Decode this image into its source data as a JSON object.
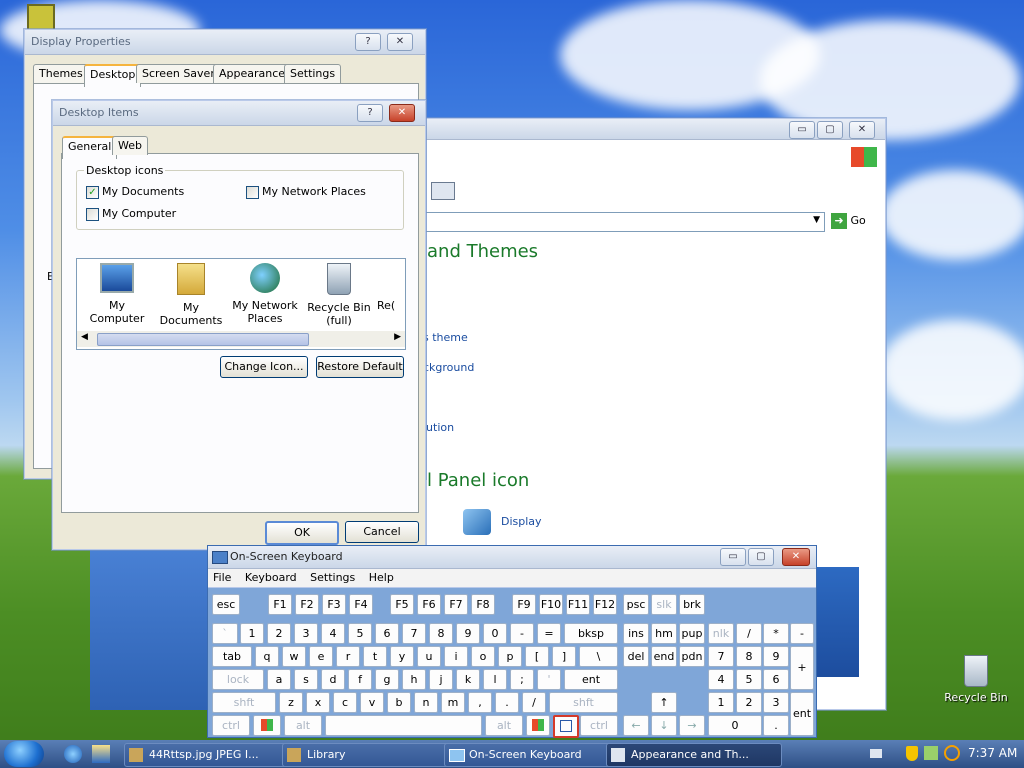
{
  "desktop": {
    "recycle_bin_label": "Recycle Bin",
    "background_colors": {
      "sky": "#2a66d8",
      "grass": "#4c8e24"
    }
  },
  "display_properties": {
    "title": "Display Properties",
    "tabs": [
      "Themes",
      "Desktop",
      "Screen Saver",
      "Appearance",
      "Settings"
    ],
    "active_tab": "Desktop",
    "help_btn": "?",
    "close_btn": "✕",
    "partial_label": "B"
  },
  "desktop_items": {
    "title": "Desktop Items",
    "help_btn": "?",
    "close_btn": "✕",
    "tabs": [
      "General",
      "Web"
    ],
    "group_label": "Desktop icons",
    "checkboxes": [
      {
        "label": "My Documents",
        "checked": true
      },
      {
        "label": "My Network Places",
        "checked": false
      },
      {
        "label": "My Computer",
        "checked": false
      }
    ],
    "icons": [
      {
        "label": "My Computer",
        "icon": "computer-icon"
      },
      {
        "label": "My Documents",
        "icon": "folder-icon"
      },
      {
        "label": "My Network Places",
        "icon": "network-icon"
      },
      {
        "label": "Recycle Bin (full)",
        "icon": "recycle-bin-icon"
      },
      {
        "label": "Re(",
        "icon": "partial-icon"
      }
    ],
    "change_icon_btn": "Change Icon...",
    "restore_default_btn": "Restore Default",
    "ok_btn": "OK",
    "cancel_btn": "Cancel"
  },
  "control_panel": {
    "heading_1": "and Themes",
    "link_1": "s theme",
    "link_2": "ckground",
    "link_3": "lution",
    "heading_2": "l Panel icon",
    "display_label": "Display",
    "go_label": "Go",
    "min": "▭",
    "max": "▢",
    "close": "✕"
  },
  "osk": {
    "title": "On-Screen Keyboard",
    "menu": [
      "File",
      "Keyboard",
      "Settings",
      "Help"
    ],
    "rows": {
      "r1": [
        "esc",
        "F1",
        "F2",
        "F3",
        "F4",
        "F5",
        "F6",
        "F7",
        "F8",
        "F9",
        "F10",
        "F11",
        "F12",
        "psc",
        "slk",
        "brk"
      ],
      "r2": [
        "`",
        "1",
        "2",
        "3",
        "4",
        "5",
        "6",
        "7",
        "8",
        "9",
        "0",
        "-",
        "=",
        "bksp",
        "ins",
        "hm",
        "pup",
        "nlk",
        "/",
        "*",
        "-"
      ],
      "r3": [
        "tab",
        "q",
        "w",
        "e",
        "r",
        "t",
        "y",
        "u",
        "i",
        "o",
        "p",
        "[",
        "]",
        "\\",
        "del",
        "end",
        "pdn",
        "7",
        "8",
        "9",
        "+"
      ],
      "r4": [
        "lock",
        "a",
        "s",
        "d",
        "f",
        "g",
        "h",
        "j",
        "k",
        "l",
        ";",
        "'",
        "ent",
        "4",
        "5",
        "6"
      ],
      "r5": [
        "shft",
        "z",
        "x",
        "c",
        "v",
        "b",
        "n",
        "m",
        ",",
        ".",
        "/",
        "shft",
        "1",
        "2",
        "3"
      ],
      "r6": [
        "ctrl",
        "alt",
        "alt",
        "ctrl",
        "0",
        ".",
        "ent"
      ]
    }
  },
  "taskbar": {
    "items": [
      {
        "label": "44Rttsp.jpg JPEG I...",
        "active": false
      },
      {
        "label": "Library",
        "active": false
      },
      {
        "label": "On-Screen Keyboard",
        "active": false
      },
      {
        "label": "Appearance and Th...",
        "active": true
      }
    ],
    "clock": "7:37 AM"
  }
}
